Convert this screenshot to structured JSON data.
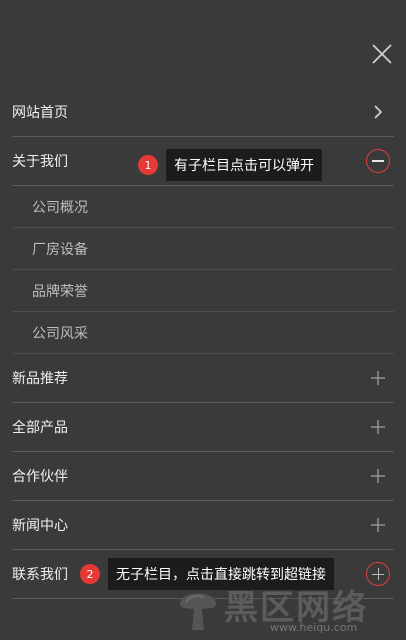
{
  "menu": {
    "items": [
      {
        "label": "网站首页",
        "icon": "chevron-right-icon"
      },
      {
        "label": "关于我们",
        "icon": "minus-circle-icon",
        "expanded": true,
        "children": [
          "公司概况",
          "厂房设备",
          "品牌荣誉",
          "公司风采"
        ]
      },
      {
        "label": "新品推荐",
        "icon": "plus-icon"
      },
      {
        "label": "全部产品",
        "icon": "plus-icon"
      },
      {
        "label": "合作伙伴",
        "icon": "plus-icon"
      },
      {
        "label": "新闻中心",
        "icon": "plus-icon"
      },
      {
        "label": "联系我们",
        "icon": "plus-circle-icon"
      }
    ]
  },
  "annotations": [
    {
      "badge": "1",
      "text": "有子栏目点击可以弹开"
    },
    {
      "badge": "2",
      "text": "无子栏目，点击直接跳转到超链接"
    }
  ],
  "watermark": {
    "title": "黑区网络",
    "url": "www.heiqu.com"
  },
  "colors": {
    "background": "#3a3a3a",
    "accent": "#e53935",
    "divider": "#5a5a5a",
    "tooltip": "#1c1c1c"
  }
}
